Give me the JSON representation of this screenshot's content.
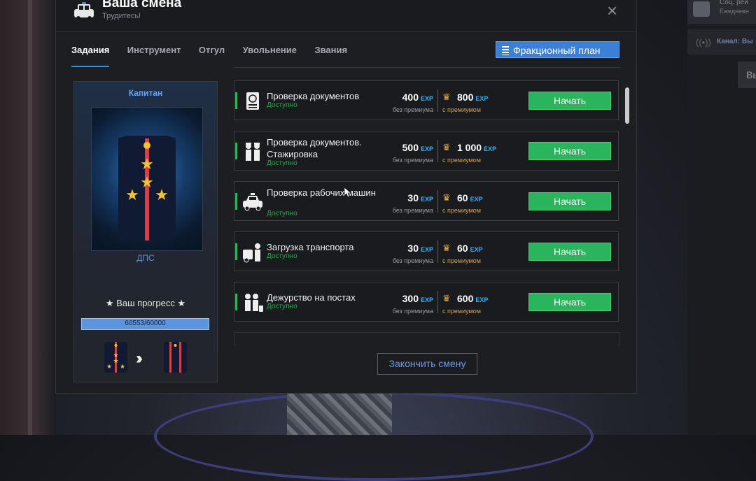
{
  "window": {
    "title": "Ваша смена",
    "subtitle": "Трудитесь!",
    "close_icon": "×"
  },
  "tabs": [
    {
      "label": "Задания",
      "active": true
    },
    {
      "label": "Инструмент",
      "active": false
    },
    {
      "label": "Отгул",
      "active": false
    },
    {
      "label": "Увольнение",
      "active": false
    },
    {
      "label": "Звания",
      "active": false
    }
  ],
  "plan_button": {
    "label": "Фракционный план"
  },
  "rank": {
    "name": "Капитан",
    "department": "ДПС",
    "progress_label": "★ Ваш прогресс ★",
    "progress_text": "60553/60000",
    "progress_fraction": 1.0
  },
  "labels": {
    "without_premium": "без премиума",
    "with_premium": "с премиумом",
    "available": "Доступно",
    "start": "Начать",
    "exp": "EXP"
  },
  "tasks": [
    {
      "name": "Проверка документов",
      "base": "400",
      "premium": "800",
      "icon": "passport-icon"
    },
    {
      "name": "Проверка документов. Стажировка",
      "base": "500",
      "premium": "1 000",
      "icon": "officers-icon"
    },
    {
      "name": "Проверка рабочих машин",
      "base": "30",
      "premium": "60",
      "icon": "police-car-icon"
    },
    {
      "name": "Загрузка транспорта",
      "base": "30",
      "premium": "60",
      "icon": "tow-truck-icon"
    },
    {
      "name": "Дежурство на постах",
      "base": "300",
      "premium": "600",
      "icon": "post-duty-icon"
    }
  ],
  "finish_button": {
    "label": "Закончить смену"
  },
  "side_panel": {
    "line1": "Соц. рей",
    "line2": "Ежедневн",
    "channel": "Канал: Вы",
    "button": "Вы"
  },
  "colors": {
    "accent": "#3c7fd6",
    "start_button": "#2ab45b",
    "exp": "#2bb2ff",
    "crown": "#f2b12a"
  }
}
